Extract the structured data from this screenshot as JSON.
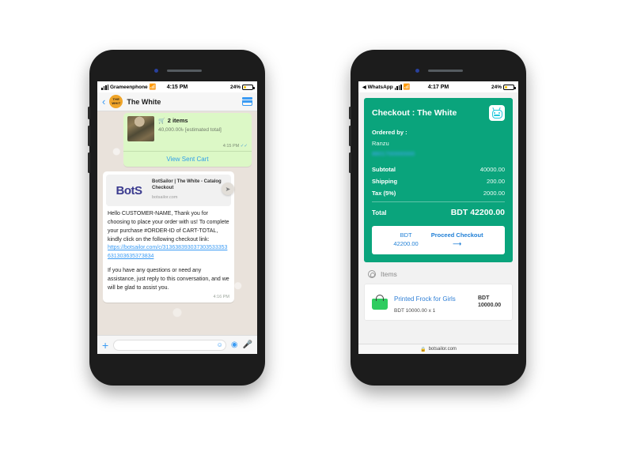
{
  "left_phone": {
    "statusbar": {
      "carrier": "Grameenphone",
      "wifi_icon": "wifi-icon",
      "time": "4:15 PM",
      "battery": "24%"
    },
    "header": {
      "back_icon": "chevron-left-icon",
      "avatar_line1": "THE",
      "avatar_line2": "WHIT",
      "title": "The White",
      "catalog_icon": "catalog-icon"
    },
    "cart_message": {
      "cart_icon": "shopping-cart-icon",
      "items_label": "2 items",
      "estimated_total": "40,000.00৳ [estimated total]",
      "time": "4:15 PM",
      "tick_icon": "double-check-icon",
      "view_cart_label": "View Sent Cart"
    },
    "incoming_message": {
      "forward_icon": "forward-arrow-icon",
      "preview": {
        "logo_text": "BotS",
        "title": "BotSailor | The White - Catalog Checkout",
        "domain": "botsailor.com"
      },
      "paragraph1_a": "Hello CUSTOMER-NAME, Thank you for choosing to place your order with us! To complete your purchase #ORDER-ID of CART-TOTAL, kindly click on the following checkout link: ",
      "link_text": "https://botsailor.com/c/313638393037303533353631303635373834",
      "paragraph2": "If you have any questions or need any assistance, just reply to this conversation, and we will be glad to assist you.",
      "time": "4:16 PM"
    },
    "input_bar": {
      "plus_icon": "plus-icon",
      "placeholder": "",
      "sticker_icon": "sticker-icon",
      "camera_icon": "camera-icon",
      "mic_icon": "microphone-icon"
    }
  },
  "right_phone": {
    "statusbar": {
      "back_app": "WhatsApp",
      "back_icon": "back-triangle-icon",
      "signal_icon": "signal-bars-icon",
      "wifi_icon": "wifi-icon",
      "time": "4:17 PM",
      "battery": "24%"
    },
    "checkout": {
      "title": "Checkout : The White",
      "bot_icon": "botsailor-robot-icon",
      "ordered_by_label": "Ordered by :",
      "customer_name": "Ranzu",
      "customer_phone": "8801700000000",
      "rows": [
        {
          "label": "Subtotal",
          "value": "40000.00"
        },
        {
          "label": "Shipping",
          "value": "200.00"
        },
        {
          "label": "Tax (5%)",
          "value": "2000.00"
        }
      ],
      "total_label": "Total",
      "total_value": "BDT 42200.00",
      "button": {
        "currency": "BDT",
        "amount": "42200.00",
        "action_label": "Proceed Checkout",
        "arrow_icon": "arrow-right-icon"
      }
    },
    "items_section": {
      "whatsapp_icon": "whatsapp-icon",
      "title": "Items",
      "items": [
        {
          "bag_icon": "shopping-bag-icon",
          "name": "Printed Frock for Girls",
          "qty_line": "BDT 10000.00 x 1",
          "price": "BDT 10000.00"
        }
      ]
    },
    "browser_bar": {
      "lock_icon": "lock-icon",
      "domain": "botsailor.com"
    }
  },
  "colors": {
    "whatsapp_green": "#0aa47c",
    "bubble_green": "#dcf8c6",
    "link_blue": "#3a9bf4",
    "accent_orange": "#f0a52a",
    "bag_green": "#2ecc5f"
  }
}
